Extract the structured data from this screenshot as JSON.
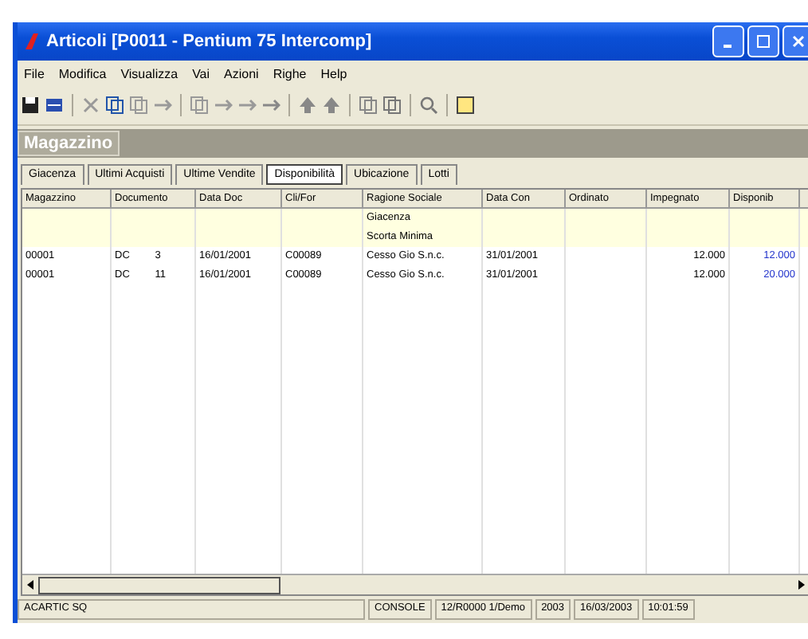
{
  "window": {
    "title": "Articoli [P0011 - Pentium 75 Intercomp]"
  },
  "menu": [
    "File",
    "Modifica",
    "Visualizza",
    "Vai",
    "Azioni",
    "Righe",
    "Help"
  ],
  "panel": {
    "title": "Magazzino"
  },
  "tabs": [
    {
      "label": "Giacenza",
      "selected": false
    },
    {
      "label": "Ultimi Acquisti",
      "selected": false
    },
    {
      "label": "Ultime Vendite",
      "selected": false
    },
    {
      "label": "Disponibilità",
      "selected": true
    },
    {
      "label": "Ubicazione",
      "selected": false
    },
    {
      "label": "Lotti",
      "selected": false
    }
  ],
  "table": {
    "columns": [
      "Magazzino",
      "Documento",
      "Data Doc",
      "Cli/For",
      "Ragione Sociale",
      "Data Con",
      "Ordinato",
      "Impegnato",
      "Disponib"
    ],
    "rows": [
      {
        "kind": "summary",
        "cells": [
          "",
          "",
          "",
          "",
          "Giacenza",
          "",
          "",
          "",
          ""
        ]
      },
      {
        "kind": "summary",
        "cells": [
          "",
          "",
          "",
          "",
          "Scorta Minima",
          "",
          "",
          "",
          ""
        ]
      },
      {
        "kind": "document",
        "cells": [
          "00001",
          "DC 3",
          "16/01/2001",
          "C00089",
          "Cesso Gio S.n.c.",
          "31/01/2001",
          "",
          "12.000",
          "12.000"
        ]
      },
      {
        "kind": "document",
        "cells": [
          "00001",
          "DC 11",
          "16/01/2001",
          "C00089",
          "Cesso Gio S.n.c.",
          "31/01/2001",
          "",
          "12.000",
          "20.000"
        ]
      }
    ]
  },
  "status_bar": [
    "ACARTIC SQ",
    "CONSOLE",
    "12/R0000 1/Demo",
    "2003",
    "16/03/2003",
    "10:01:59"
  ]
}
